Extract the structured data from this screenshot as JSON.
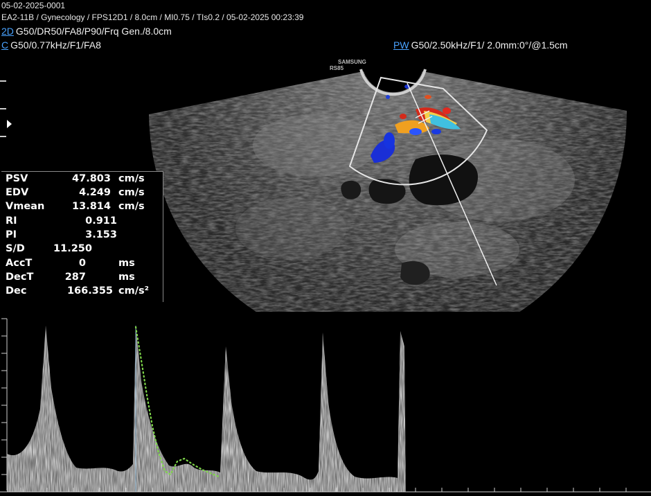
{
  "header": {
    "patient_id": "05-02-2025-0001",
    "info_line": "EA2-11B / Gynecology / FPS12D1 / 8.0cm / MI0.75 / TIs0.2 / 05-02-2025 00:23:39"
  },
  "modes": {
    "mode_2d": {
      "tag": "2D",
      "params": "G50/DR50/FA8/P90/Frq Gen./8.0cm"
    },
    "mode_c": {
      "tag": "C",
      "params": "G50/0.77kHz/F1/FA8"
    },
    "mode_pw": {
      "tag": "PW",
      "params": "G50/2.50kHz/F1/ 2.0mm:0°/@1.5cm"
    }
  },
  "probe_logo": {
    "line1": "SAMSUNG",
    "line2": "RS85"
  },
  "measurements": [
    {
      "label": "PSV",
      "value": "47.803",
      "unit": "cm/s"
    },
    {
      "label": "EDV",
      "value": "4.249",
      "unit": "cm/s"
    },
    {
      "label": "Vmean",
      "value": "13.814",
      "unit": "cm/s"
    },
    {
      "label": "RI",
      "value": "0.911",
      "unit": ""
    },
    {
      "label": "PI",
      "value": "3.153",
      "unit": ""
    },
    {
      "label": "S/D",
      "value": "11.250",
      "unit": ""
    },
    {
      "label": "AccT",
      "value": "0",
      "unit": "ms"
    },
    {
      "label": "DecT",
      "value": "287",
      "unit": "ms"
    },
    {
      "label": "Dec",
      "value": "166.355",
      "unit": "cm/s²"
    }
  ],
  "colors": {
    "mode_tag": "#4aa3ff",
    "trace_dots": "#7fd84a",
    "spectrum": "#d8d8d8"
  }
}
